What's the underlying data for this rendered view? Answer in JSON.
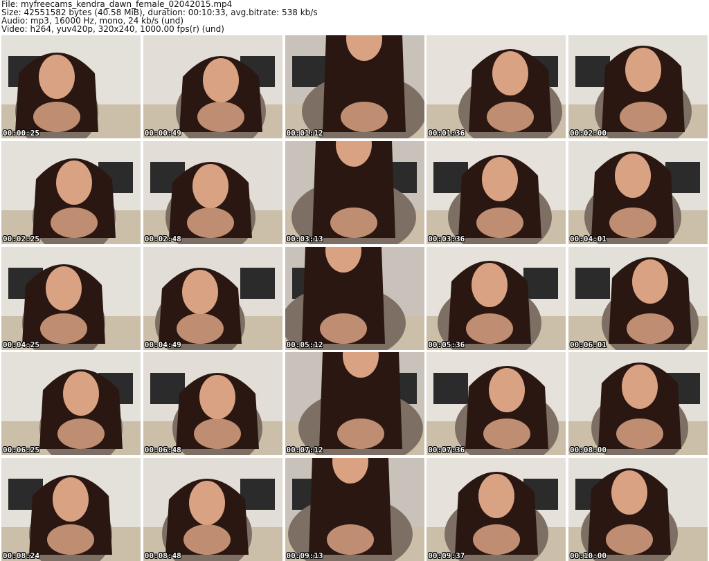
{
  "header": {
    "file_line": "File: myfreecams_kendra_dawn_female_02042015.mp4",
    "size_line": "Size: 42551582 bytes (40.58 MiB), duration: 00:10:33, avg.bitrate: 538 kb/s",
    "audio_line": "Audio: mp3, 16000 Hz, mono, 24 kb/s (und)",
    "video_line": "Video: h264, yuv420p, 320x240, 1000.00 fps(r) (und)"
  },
  "thumbnails": [
    {
      "timestamp": "00:00:25"
    },
    {
      "timestamp": "00:00:49"
    },
    {
      "timestamp": "00:01:12"
    },
    {
      "timestamp": "00:01:36"
    },
    {
      "timestamp": "00:02:00"
    },
    {
      "timestamp": "00:02:25"
    },
    {
      "timestamp": "00:02:48"
    },
    {
      "timestamp": "00:03:13"
    },
    {
      "timestamp": "00:03:36"
    },
    {
      "timestamp": "00:04:01"
    },
    {
      "timestamp": "00:04:25"
    },
    {
      "timestamp": "00:04:49"
    },
    {
      "timestamp": "00:05:12"
    },
    {
      "timestamp": "00:05:36"
    },
    {
      "timestamp": "00:06:01"
    },
    {
      "timestamp": "00:06:25"
    },
    {
      "timestamp": "00:06:48"
    },
    {
      "timestamp": "00:07:12"
    },
    {
      "timestamp": "00:07:36"
    },
    {
      "timestamp": "00:08:00"
    },
    {
      "timestamp": "00:08:24"
    },
    {
      "timestamp": "00:08:48"
    },
    {
      "timestamp": "00:09:13"
    },
    {
      "timestamp": "00:09:37"
    },
    {
      "timestamp": "00:10:00"
    }
  ],
  "colors": {
    "background": "#ffffff",
    "header_text": "#111111",
    "timestamp_text": "#ffffff",
    "timestamp_outline": "#000000",
    "frame_wall": "#d9d4cc",
    "frame_hair": "#2a1712",
    "frame_skin": "#d9a283",
    "frame_dress": "#7d6f63"
  }
}
